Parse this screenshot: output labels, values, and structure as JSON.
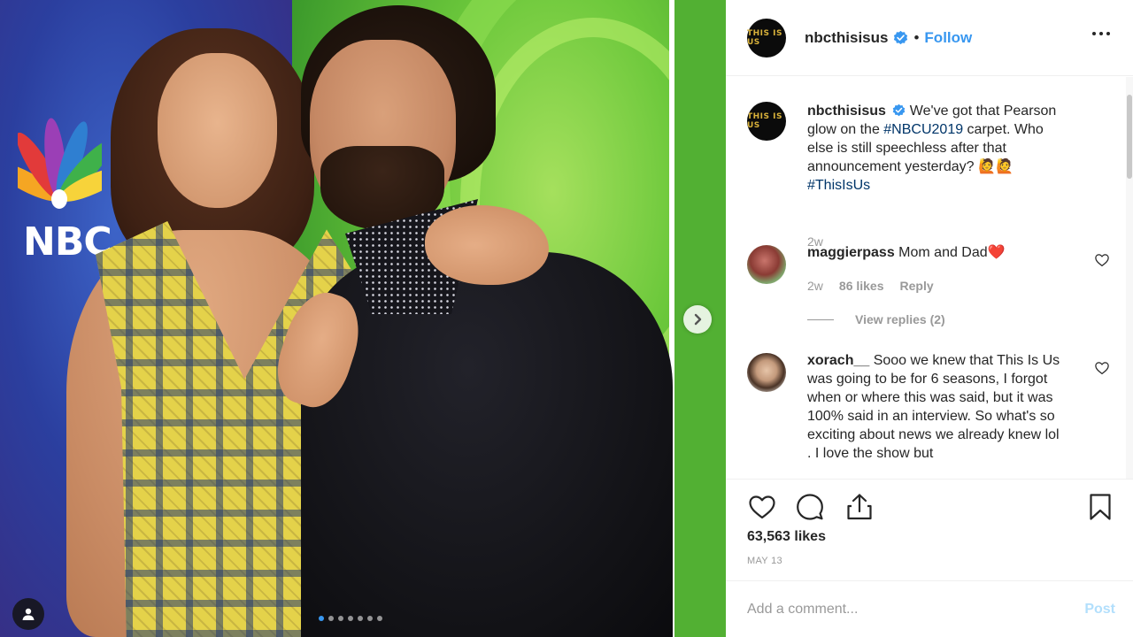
{
  "photo": {
    "backdrop_logo_text": "NBC",
    "carousel": {
      "count": 7,
      "active_index": 0
    }
  },
  "post": {
    "username": "nbcthisisus",
    "avatar_text": "THIS IS US",
    "follow_label": "Follow",
    "separator": "•",
    "caption": {
      "username": "nbcthisisus",
      "text_before": " We've got that Pearson glow on the ",
      "hashtag1": "#NBCU2019",
      "text_after": " carpet. Who else is still speechless after that announcement yesterday? 🙋🙋",
      "hashtag2": "#ThisIsUs",
      "age": "2w"
    },
    "comments": [
      {
        "username": "maggierpass",
        "text": " Mom and Dad❤️",
        "age": "2w",
        "likes": "86 likes",
        "reply_label": "Reply",
        "view_replies": "View replies (2)"
      },
      {
        "username": "xorach__",
        "text": " Sooo we knew that This Is Us was going to be for 6 seasons, I forgot when or where this was said, but it was 100% said in an interview. So what's so exciting about news we already knew lol . I love the show but"
      }
    ],
    "likes_count": "63,563 likes",
    "date": "MAY 13",
    "comment_placeholder": "Add a comment...",
    "post_label": "Post"
  },
  "colors": {
    "accent": "#3897f0",
    "hashtag": "#003569",
    "muted": "#999999",
    "text": "#262626",
    "post_disabled": "#b2dffc"
  }
}
